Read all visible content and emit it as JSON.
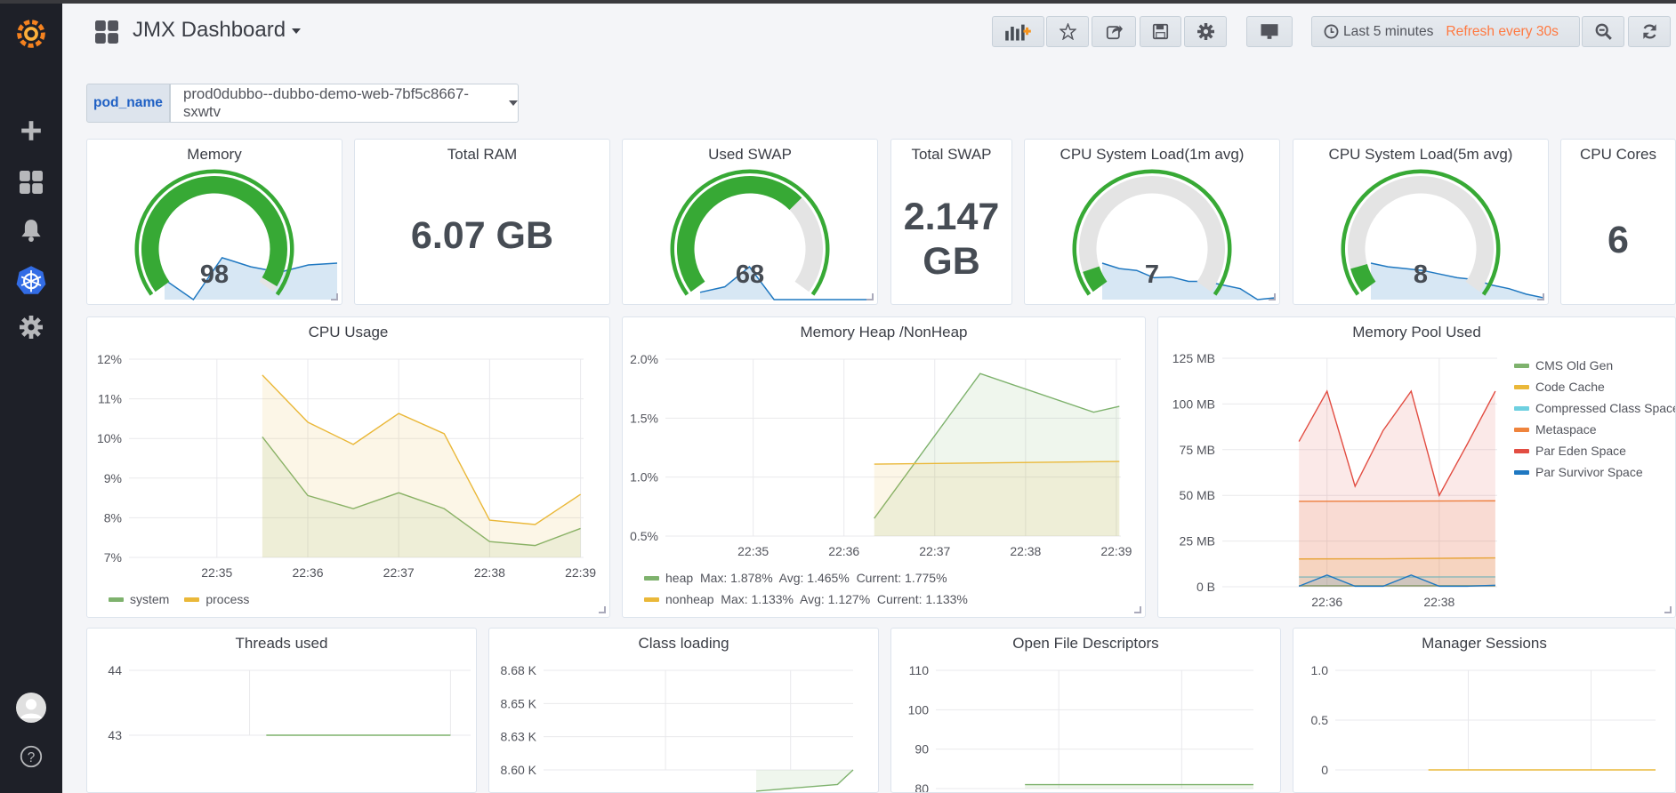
{
  "header": {
    "title": "JMX Dashboard",
    "buttons": [
      "add-panel",
      "star",
      "share",
      "save",
      "settings",
      "tv-mode"
    ],
    "time_range": "Last 5 minutes",
    "refresh": "Refresh every 30s",
    "refresh_color": "#ff7941"
  },
  "sidebar": {
    "items": [
      "grafana-logo",
      "create",
      "dashboards",
      "alerting",
      "kubernetes",
      "configuration",
      "profile",
      "help"
    ]
  },
  "variables": {
    "label": "pod_name",
    "value": "prod0dubbo--dubbo-demo-web-7bf5c8667-sxwtv"
  },
  "colors": {
    "green": "#37a935",
    "gauge_bg": "#e4e4e4",
    "sparkline": "#1f78c1"
  },
  "stats": {
    "memory": {
      "title": "Memory",
      "value": "98",
      "fraction": 0.98,
      "sparkline": [
        0.55,
        0.0,
        1.15,
        0.9,
        0.75,
        0.95,
        1.0
      ]
    },
    "total_ram": {
      "title": "Total RAM",
      "value": "6.07 GB"
    },
    "used_swap": {
      "title": "Used SWAP",
      "value": "68",
      "fraction": 0.68,
      "sparkline": [
        0.2,
        0.35,
        0.9,
        0.0,
        0.0,
        0.0,
        0.0,
        0.0
      ]
    },
    "total_swap": {
      "title": "Total SWAP",
      "value_line1": "2.147",
      "value_line2": "GB"
    },
    "cpu_load_1m": {
      "title": "CPU System Load(1m avg)",
      "value": "7",
      "fraction": 0.07,
      "sparkline": [
        1.0,
        0.85,
        0.8,
        0.6,
        0.62,
        0.5,
        0.5,
        0.4,
        0.3,
        0.0,
        0.05
      ]
    },
    "cpu_load_5m": {
      "title": "CPU System Load(5m avg)",
      "value": "8",
      "fraction": 0.08,
      "sparkline": [
        1.0,
        0.9,
        0.85,
        0.8,
        0.7,
        0.6,
        0.55,
        0.4,
        0.3,
        0.15,
        0.05
      ]
    },
    "cpu_cores": {
      "title": "CPU Cores",
      "value": "6"
    }
  },
  "chart_data": [
    {
      "id": "cpu",
      "type": "line",
      "title": "CPU Usage",
      "xlim": [
        "22:34:02",
        "22:39:02"
      ],
      "xticks": [
        "22:35",
        "22:36",
        "22:37",
        "22:38",
        "22:39"
      ],
      "ylim": [
        7,
        12
      ],
      "yticks": [
        7,
        8,
        9,
        10,
        11,
        12
      ],
      "ytick_labels": [
        "7%",
        "8%",
        "9%",
        "10%",
        "11%",
        "12%"
      ],
      "series": [
        {
          "name": "system",
          "color": "#7eb26d",
          "x": [
            "22:35:30",
            "22:36:00",
            "22:36:30",
            "22:37:00",
            "22:37:30",
            "22:38:00",
            "22:38:30",
            "22:39:00"
          ],
          "y": [
            10.04,
            8.56,
            8.23,
            8.63,
            8.23,
            7.4,
            7.3,
            7.73
          ]
        },
        {
          "name": "process",
          "color": "#eab839",
          "x": [
            "22:35:30",
            "22:36:00",
            "22:36:30",
            "22:37:00",
            "22:37:30",
            "22:38:00",
            "22:38:30",
            "22:39:00"
          ],
          "y": [
            11.6,
            10.41,
            9.85,
            10.63,
            10.12,
            7.94,
            7.83,
            8.59
          ]
        }
      ],
      "legend": [
        {
          "name": "system"
        },
        {
          "name": "process"
        }
      ]
    },
    {
      "id": "heap",
      "type": "line",
      "title": "Memory Heap /NonHeap",
      "xlim": [
        "22:34:02",
        "22:39:03"
      ],
      "xticks": [
        "22:35",
        "22:36",
        "22:37",
        "22:38",
        "22:39"
      ],
      "ylim": [
        0.5,
        2.0
      ],
      "yticks": [
        0.5,
        1.0,
        1.5,
        2.0
      ],
      "ytick_labels": [
        "0.5%",
        "1.0%",
        "1.5%",
        "2.0%"
      ],
      "series": [
        {
          "name": "heap",
          "color": "#7eb26d",
          "x": [
            "22:36:20",
            "22:37:30",
            "22:38:45",
            "22:39:02"
          ],
          "y": [
            0.65,
            1.878,
            1.55,
            1.6
          ]
        },
        {
          "name": "nonheap",
          "color": "#eab839",
          "x": [
            "22:36:20",
            "22:39:02"
          ],
          "y": [
            1.11,
            1.133
          ]
        }
      ],
      "legend": [
        {
          "name": "heap",
          "stats": "Max: 1.878%  Avg: 1.465%  Current: 1.775%"
        },
        {
          "name": "nonheap",
          "stats": "Max: 1.133%  Avg: 1.127%  Current: 1.133%"
        }
      ]
    },
    {
      "id": "pool",
      "type": "line",
      "title": "Memory Pool Used",
      "xlim": [
        "22:34:08",
        "22:39:02"
      ],
      "xticks": [
        "22:36",
        "22:38"
      ],
      "xgrid": [
        "22:36",
        "22:38"
      ],
      "ylim": [
        0,
        125
      ],
      "yticks": [
        0,
        25,
        50,
        75,
        100,
        125
      ],
      "ytick_labels": [
        "0 B",
        "25 MB",
        "50 MB",
        "75 MB",
        "100 MB",
        "125 MB"
      ],
      "series": [
        {
          "name": "CMS Old Gen",
          "color": "#7eb26d",
          "x": [
            "22:35:30",
            "22:39:00"
          ],
          "y": [
            0.6,
            0.6
          ]
        },
        {
          "name": "Code Cache",
          "color": "#eab839",
          "x": [
            "22:35:30",
            "22:37:00",
            "22:39:00"
          ],
          "y": [
            15.2,
            15.3,
            15.8
          ]
        },
        {
          "name": "Compressed Class Space",
          "color": "#6ed0e0",
          "x": [
            "22:35:30",
            "22:39:00"
          ],
          "y": [
            5.3,
            5.4
          ]
        },
        {
          "name": "Metaspace",
          "color": "#ef843c",
          "x": [
            "22:35:30",
            "22:39:00"
          ],
          "y": [
            46.7,
            47.0
          ]
        },
        {
          "name": "Par Eden Space",
          "color": "#e24d42",
          "x": [
            "22:35:30",
            "22:36:00",
            "22:36:30",
            "22:37:00",
            "22:37:30",
            "22:38:00",
            "22:38:30",
            "22:39:00"
          ],
          "y": [
            79.5,
            107,
            55,
            85.5,
            107,
            50,
            78,
            107
          ]
        },
        {
          "name": "Par Survivor Space",
          "color": "#1f78c1",
          "x": [
            "22:35:30",
            "22:36:00",
            "22:36:30",
            "22:37:00",
            "22:37:30",
            "22:38:00",
            "22:38:30",
            "22:39:00"
          ],
          "y": [
            0.3,
            6.4,
            0.3,
            0.3,
            6.4,
            0.3,
            0.3,
            0.8
          ]
        }
      ],
      "legend": [
        {
          "name": "CMS Old Gen"
        },
        {
          "name": "Code Cache"
        },
        {
          "name": "Compressed Class Space"
        },
        {
          "name": "Metaspace"
        },
        {
          "name": "Par Eden Space"
        },
        {
          "name": "Par Survivor Space"
        }
      ]
    },
    {
      "id": "threads",
      "type": "line",
      "title": "Threads used",
      "xlim": [
        "22:35:48",
        "22:39:12"
      ],
      "xticks": [],
      "xgrid": [
        "22:37",
        "22:39"
      ],
      "ylim": [
        43,
        44
      ],
      "yticks": [
        43,
        44
      ],
      "ytick_labels": [
        "43",
        "44"
      ],
      "series": [
        {
          "color": "#7eb26d",
          "x": [
            "22:37:10",
            "22:39:00"
          ],
          "y": [
            43,
            43
          ]
        }
      ]
    },
    {
      "id": "classes",
      "type": "line",
      "title": "Class loading",
      "xlim": [
        "22:34:03",
        "22:39:00"
      ],
      "xticks": [],
      "xgrid": [
        "22:36",
        "22:38"
      ],
      "ylim": [
        8605,
        8680
      ],
      "yticks": [
        8605,
        8630,
        8655,
        8680
      ],
      "ytick_labels": [
        "8.60 K",
        "8.63 K",
        "8.65 K",
        "8.68 K"
      ],
      "series": [
        {
          "color": "#7eb26d",
          "x": [
            "22:37:27",
            "22:38:45",
            "22:39:00"
          ],
          "y": [
            8589,
            8594,
            8605
          ]
        }
      ]
    },
    {
      "id": "fds",
      "type": "line",
      "title": "Open File Descriptors",
      "xlim": [
        "22:34:00",
        "22:39:10"
      ],
      "xticks": [],
      "xgrid": [
        "22:36",
        "22:38"
      ],
      "ylim": [
        80,
        110
      ],
      "yticks": [
        80,
        90,
        100,
        110
      ],
      "ytick_labels": [
        "80",
        "90",
        "100",
        "110"
      ],
      "series": [
        {
          "color": "#7eb26d",
          "x": [
            "22:35:27",
            "22:39:10"
          ],
          "y": [
            81,
            81
          ]
        }
      ]
    },
    {
      "id": "sessions",
      "type": "line",
      "title": "Manager Sessions",
      "xlim": [
        "22:33:50",
        "22:39:03"
      ],
      "xticks": [],
      "xgrid": [
        "22:36",
        "22:38"
      ],
      "ylim": [
        0,
        1
      ],
      "yticks": [
        0,
        0.5,
        1
      ],
      "ytick_labels": [
        "0",
        "0.5",
        "1.0"
      ],
      "series": [
        {
          "color": "#eab839",
          "x": [
            "22:35:21",
            "22:39:03"
          ],
          "y": [
            0,
            0
          ]
        }
      ]
    }
  ]
}
